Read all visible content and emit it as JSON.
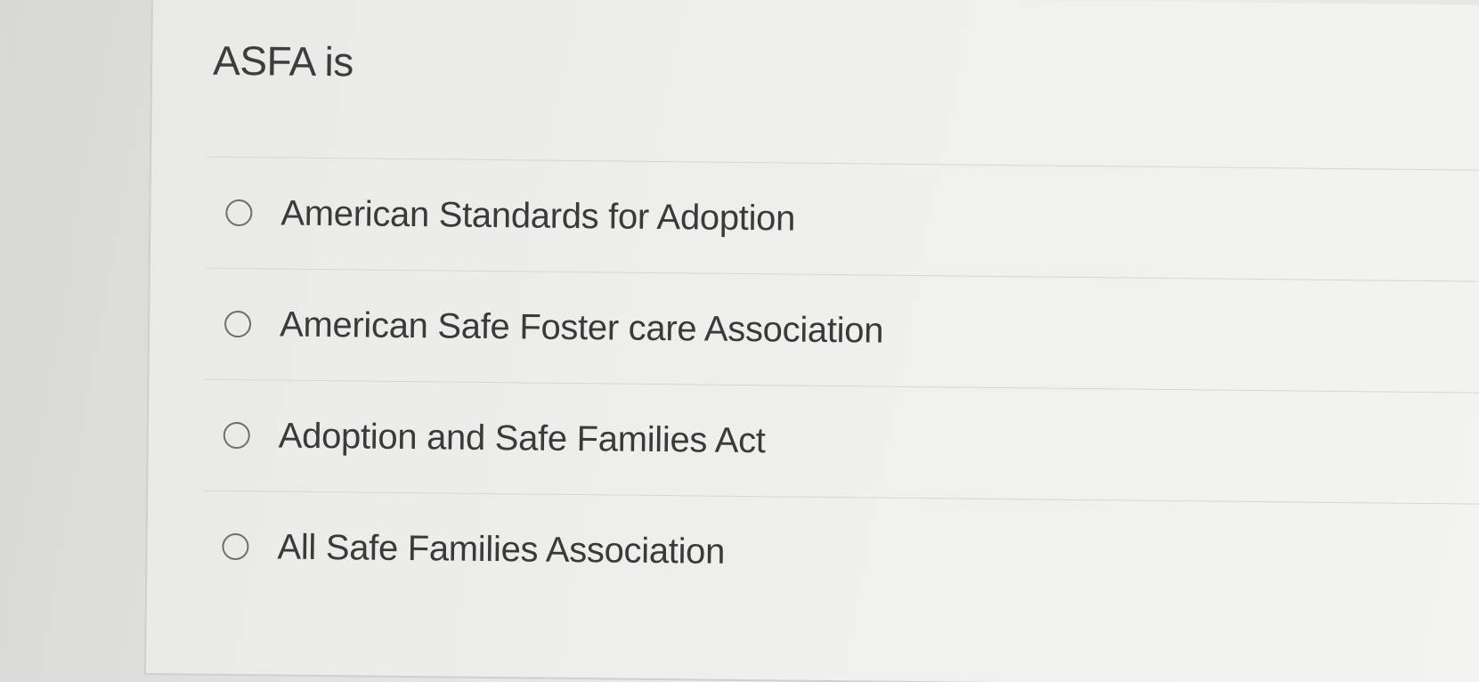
{
  "question": {
    "text": "ASFA is"
  },
  "options": [
    {
      "label": "American Standards for Adoption",
      "selected": false
    },
    {
      "label": "American Safe Foster care Association",
      "selected": false
    },
    {
      "label": "Adoption and Safe Families Act",
      "selected": false
    },
    {
      "label": "All Safe Families Association",
      "selected": false
    }
  ],
  "colors": {
    "text": "#3a3a3a",
    "radio_border": "#6e6e6e",
    "divider": "#d6d6d4"
  }
}
